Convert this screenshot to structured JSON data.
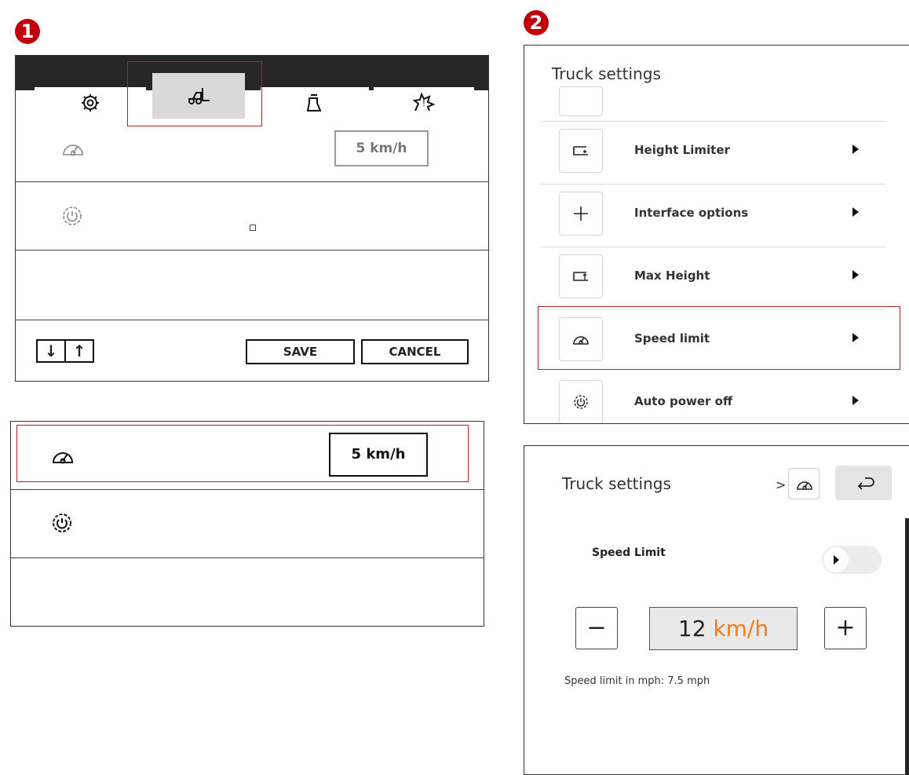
{
  "badges": {
    "left": "1",
    "right": "2"
  },
  "panel1": {
    "tabs": [
      "settings-icon",
      "forklift-icon",
      "load-weight-icon",
      "alert-icon"
    ],
    "rows": [
      {
        "icon": "speedometer-icon",
        "value": "5 km/h"
      },
      {
        "icon": "power-gear-icon",
        "value": ""
      },
      {
        "icon": "",
        "value": ""
      }
    ],
    "buttons": {
      "down": "↓",
      "up": "↑",
      "save": "SAVE",
      "cancel": "CANCEL"
    }
  },
  "panel1b": {
    "rows": [
      {
        "icon": "speedometer-icon",
        "value": "5 km/h"
      },
      {
        "icon": "power-gear-icon",
        "value": ""
      },
      {
        "icon": "",
        "value": ""
      }
    ]
  },
  "panel2": {
    "title": "Truck settings",
    "items": [
      {
        "label": "Height Limiter",
        "icon": "height-limiter-icon"
      },
      {
        "label": "Interface options",
        "icon": "plus-icon"
      },
      {
        "label": "Max Height",
        "icon": "max-height-icon"
      },
      {
        "label": "Speed limit",
        "icon": "speedometer-icon"
      },
      {
        "label": "Auto power off",
        "icon": "power-gear-icon"
      }
    ]
  },
  "panel3": {
    "breadcrumb_title": "Truck settings",
    "breadcrumb_sep": ">",
    "setting_label": "Speed Limit",
    "value_number": "12",
    "value_unit": "km/h",
    "minus": "−",
    "plus": "+",
    "note": "Speed limit in mph: 7.5 mph"
  },
  "colors": {
    "accent": "#f07d1e",
    "highlight": "#b2202a",
    "badge": "#c0000a"
  }
}
